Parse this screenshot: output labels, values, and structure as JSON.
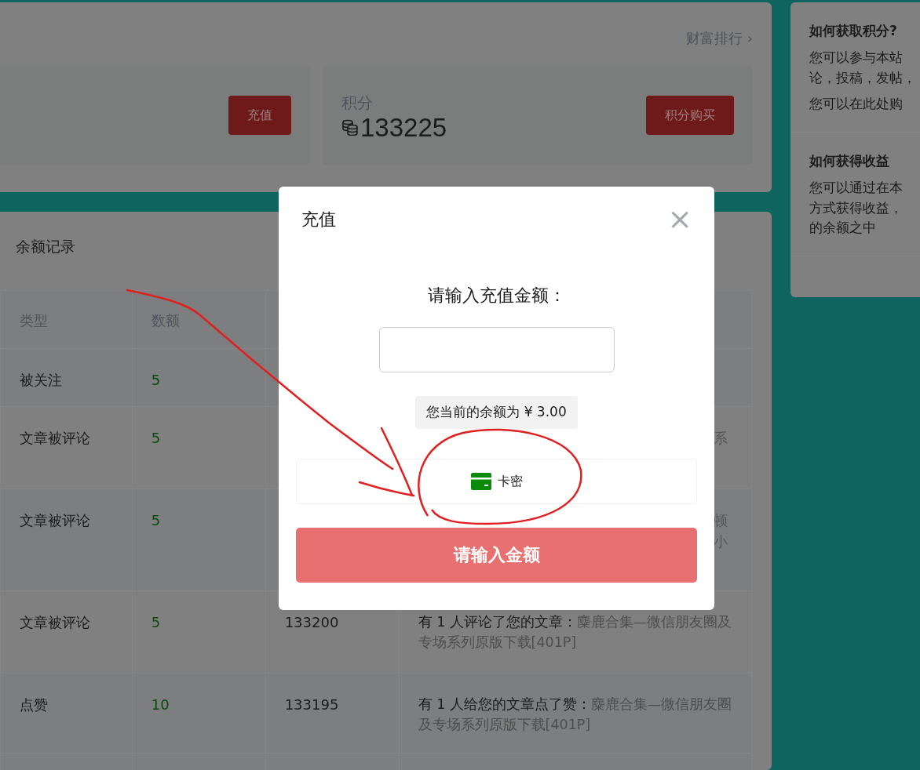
{
  "wealth": {
    "ranking_link": "财富排行 ›",
    "recharge_button": "充值",
    "points": {
      "label": "积分",
      "value": "133225",
      "buy_button": "积分购买"
    }
  },
  "records": {
    "title": "余额记录",
    "columns": [
      "类型",
      "数额"
    ],
    "rows": [
      {
        "type": "被关注",
        "amount": "5",
        "balance": "",
        "detail_lines": []
      },
      {
        "type": "文章被评论",
        "amount": "5",
        "balance": "",
        "detail_lines": [
          "系"
        ]
      },
      {
        "type": "文章被评论",
        "amount": "5",
        "balance": "",
        "detail_lines": [
          "顿",
          "小"
        ]
      },
      {
        "type": "文章被评论",
        "amount": "5",
        "balance": "133200",
        "detail": "有 1 人评论了您的文章：",
        "link": "麋鹿合集—微信朋友圈及专场系列原版下载[401P]"
      },
      {
        "type": "点赞",
        "amount": "10",
        "balance": "133195",
        "detail": "有 1 人给您的文章点了赞：",
        "link": "麋鹿合集—微信朋友圈及专场系列原版下载[401P]"
      }
    ]
  },
  "sidebar": [
    {
      "title": "如何获取积分?",
      "paragraphs": [
        [
          "您可以参与本站",
          "论，投稿，发帖，"
        ],
        [
          "您可以在此处购"
        ]
      ]
    },
    {
      "title": "如何获得收益",
      "paragraphs": [
        [
          "您可以通过在本",
          "方式获得收益，",
          "的余额之中"
        ]
      ]
    }
  ],
  "modal": {
    "title": "充值",
    "close": "×",
    "prompt": "请输入充值金额：",
    "balance_note": "您当前的余额为 ¥ 3.00",
    "methods": [
      {
        "label": "卡密"
      }
    ],
    "submit": {
      "label": "请输入金额",
      "disabled": true
    }
  }
}
